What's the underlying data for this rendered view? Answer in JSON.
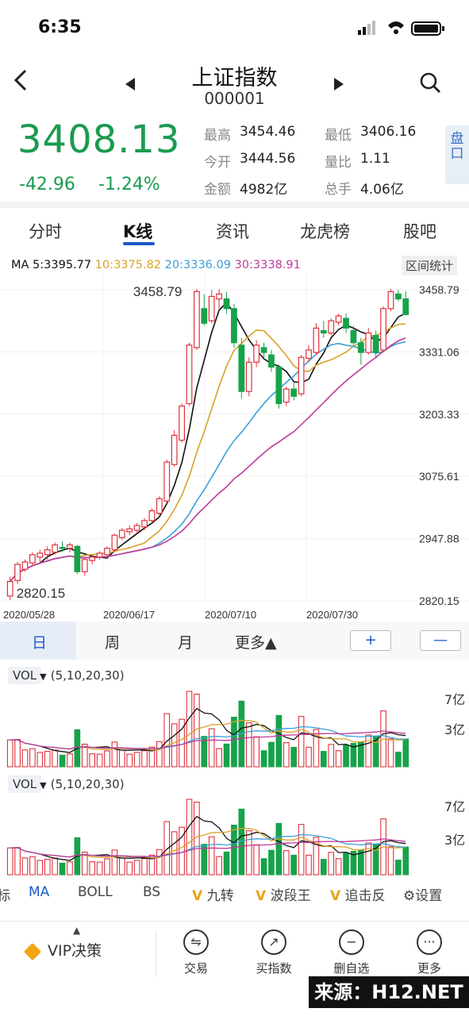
{
  "status": {
    "time": "6:35"
  },
  "header": {
    "title": "上证指数",
    "code": "000001"
  },
  "quote": {
    "price": "3408.13",
    "change": "-42.96",
    "change_pct": "-1.24%",
    "stats": [
      {
        "label": "最高",
        "value": "3454.46"
      },
      {
        "label": "最低",
        "value": "3406.16"
      },
      {
        "label": "今开",
        "value": "3444.56"
      },
      {
        "label": "量比",
        "value": "1.11"
      },
      {
        "label": "金额",
        "value": "4982亿"
      },
      {
        "label": "总手",
        "value": "4.06亿"
      }
    ],
    "pankou": "盘口"
  },
  "tabs": [
    {
      "label": "分时"
    },
    {
      "label": "K线"
    },
    {
      "label": "资讯"
    },
    {
      "label": "龙虎榜"
    },
    {
      "label": "股吧"
    }
  ],
  "ma": {
    "ma5": "MA 5:3395.77",
    "ma10": "10:3375.82",
    "ma20": "20:3336.09",
    "ma30": "30:3338.91",
    "range_stats": "区间统计"
  },
  "colors": {
    "up": "#e0303c",
    "down": "#17a34a",
    "ma5": "#111111",
    "ma10": "#d9a22a",
    "ma20": "#3aa0d8",
    "ma30": "#c0399a",
    "accent": "#1c59c9"
  },
  "chart_data": {
    "type": "candlestick",
    "y_ticks": [
      "3458.79",
      "3331.06",
      "3203.33",
      "3075.61",
      "2947.88",
      "2820.15"
    ],
    "ylim": [
      2820.15,
      3458.79
    ],
    "x_ticks": [
      "2020/05/28",
      "2020/06/17",
      "2020/07/10",
      "2020/07/30"
    ],
    "high_label": "3458.79",
    "low_label": "2820.15",
    "candles": [
      [
        2830,
        2860,
        2822,
        2870
      ],
      [
        2862,
        2895,
        2855,
        2900
      ],
      [
        2885,
        2900,
        2880,
        2905
      ],
      [
        2898,
        2915,
        2892,
        2920
      ],
      [
        2910,
        2918,
        2900,
        2925
      ],
      [
        2915,
        2925,
        2905,
        2932
      ],
      [
        2920,
        2935,
        2915,
        2940
      ],
      [
        2930,
        2928,
        2920,
        2942
      ],
      [
        2928,
        2935,
        2920,
        2940
      ],
      [
        2932,
        2880,
        2875,
        2935
      ],
      [
        2880,
        2905,
        2872,
        2908
      ],
      [
        2903,
        2910,
        2895,
        2915
      ],
      [
        2910,
        2918,
        2905,
        2922
      ],
      [
        2915,
        2928,
        2908,
        2932
      ],
      [
        2925,
        2955,
        2920,
        2958
      ],
      [
        2950,
        2965,
        2945,
        2970
      ],
      [
        2962,
        2968,
        2955,
        2975
      ],
      [
        2965,
        2975,
        2958,
        2980
      ],
      [
        2972,
        2985,
        2965,
        2990
      ],
      [
        2985,
        3005,
        2980,
        3010
      ],
      [
        3000,
        3030,
        2995,
        3035
      ],
      [
        3025,
        3105,
        3020,
        3110
      ],
      [
        3100,
        3160,
        3095,
        3170
      ],
      [
        3150,
        3220,
        3145,
        3225
      ],
      [
        3225,
        3345,
        3220,
        3350
      ],
      [
        3340,
        3455,
        3335,
        3460
      ],
      [
        3420,
        3390,
        3385,
        3450
      ],
      [
        3395,
        3445,
        3390,
        3458
      ],
      [
        3440,
        3450,
        3420,
        3460
      ],
      [
        3440,
        3420,
        3410,
        3455
      ],
      [
        3420,
        3350,
        3340,
        3430
      ],
      [
        3345,
        3250,
        3235,
        3360
      ],
      [
        3250,
        3310,
        3240,
        3320
      ],
      [
        3310,
        3345,
        3300,
        3355
      ],
      [
        3340,
        3330,
        3320,
        3350
      ],
      [
        3325,
        3300,
        3290,
        3335
      ],
      [
        3300,
        3225,
        3215,
        3305
      ],
      [
        3228,
        3255,
        3220,
        3260
      ],
      [
        3255,
        3240,
        3232,
        3270
      ],
      [
        3245,
        3320,
        3240,
        3325
      ],
      [
        3318,
        3335,
        3310,
        3345
      ],
      [
        3330,
        3380,
        3325,
        3390
      ],
      [
        3375,
        3370,
        3360,
        3395
      ],
      [
        3370,
        3395,
        3365,
        3400
      ],
      [
        3392,
        3405,
        3385,
        3410
      ],
      [
        3400,
        3380,
        3370,
        3410
      ],
      [
        3375,
        3350,
        3345,
        3385
      ],
      [
        3350,
        3330,
        3305,
        3360
      ],
      [
        3330,
        3370,
        3325,
        3380
      ],
      [
        3365,
        3330,
        3320,
        3375
      ],
      [
        3335,
        3420,
        3330,
        3425
      ],
      [
        3420,
        3455,
        3415,
        3460
      ],
      [
        3450,
        3440,
        3435,
        3458
      ],
      [
        3440,
        3408,
        3406,
        3455
      ]
    ]
  },
  "periods": [
    "日",
    "周",
    "月",
    "更多▲"
  ],
  "zoom": {
    "in": "+",
    "out": "—"
  },
  "volume": {
    "tag": "VOL",
    "params": "(5,10,20,30)",
    "ticks": [
      "7亿",
      "3亿"
    ]
  },
  "indicators": [
    {
      "label": "标"
    },
    {
      "label": "MA"
    },
    {
      "label": "BOLL"
    },
    {
      "label": "BS"
    },
    {
      "label": "九转",
      "vip": true
    },
    {
      "label": "波段王",
      "vip": true
    },
    {
      "label": "追击反",
      "vip": true
    },
    {
      "label": "设置",
      "gear": true
    }
  ],
  "bottom_bar": {
    "vip_label": "VIP决策",
    "items": [
      {
        "label": "交易",
        "icon": "⇋"
      },
      {
        "label": "买指数",
        "icon": "↗"
      },
      {
        "label": "删自选",
        "icon": "−"
      },
      {
        "label": "更多",
        "icon": "···"
      }
    ]
  },
  "watermark": "来源：H12.NET"
}
